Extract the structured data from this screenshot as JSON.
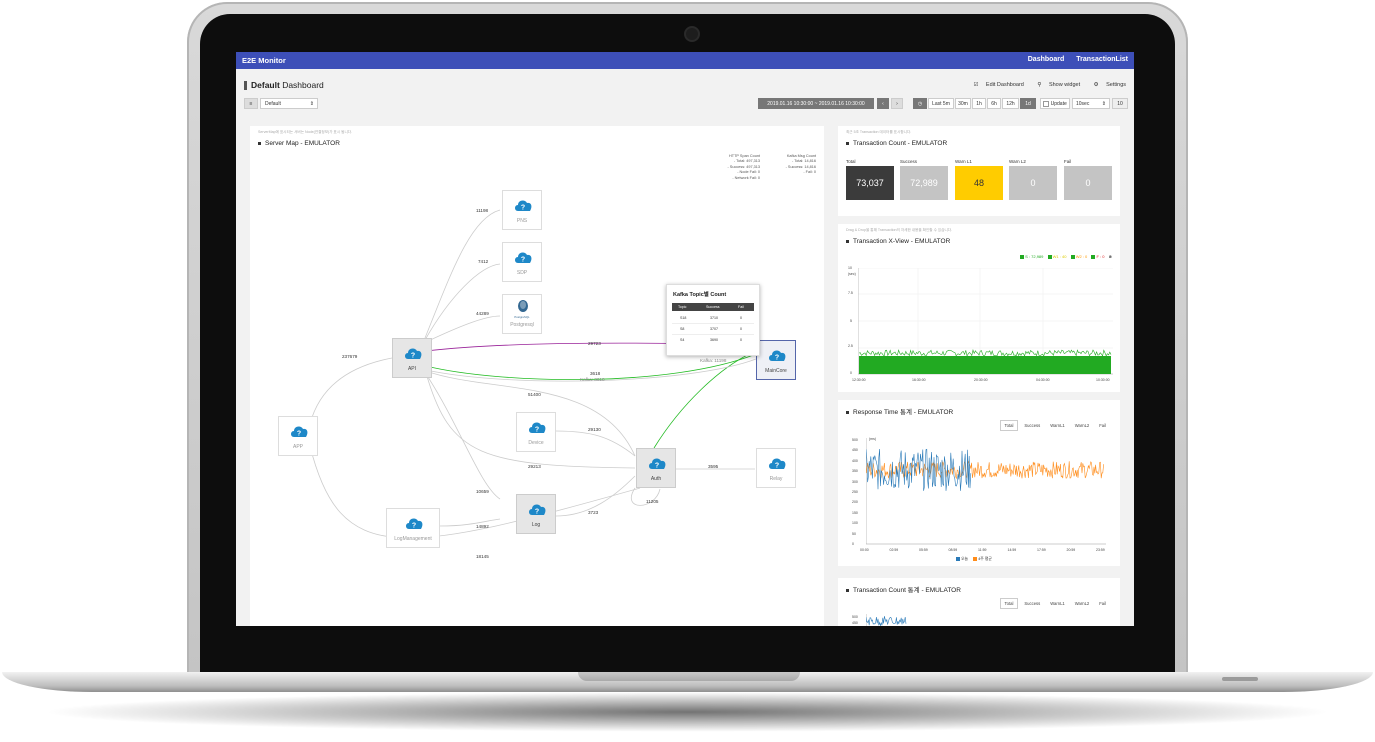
{
  "app": {
    "brand": "E2E Monitor",
    "nav": [
      "Dashboard",
      "TransactionList"
    ]
  },
  "page": {
    "title_bold": "Default",
    "title_rest": "Dashboard",
    "links": [
      "Edit Dashboard",
      "Show widget",
      "Settings"
    ]
  },
  "controls": {
    "dashboard_select": "Default",
    "date_range": "2019.01.16 10:30:00 ~ 2019.01.16 10:30:00",
    "ranges": [
      "Last 5m",
      "30m",
      "1h",
      "6h",
      "12h",
      "1d"
    ],
    "active_range": "1d",
    "update_label": "Update",
    "interval": "10sec",
    "go": "10"
  },
  "server_map": {
    "hint": "ServerMap에 표시되는 서버는 Node(연결정보)가 표시 됩니다.",
    "title": "Server Map - EMULATOR",
    "legend_http_title": "HTTP Span Count",
    "legend_http": [
      "- Total: 497,313",
      "- Success: 497,313",
      "- Node Fail: 0",
      "- Network Fail: 0"
    ],
    "legend_kafka_title": "Kafka Msg Count",
    "legend_kafka": [
      "- Total: 14,816",
      "- Success: 14,816",
      "- Fail: 0"
    ],
    "nodes": {
      "pns": "PNS",
      "sdp": "SDP",
      "postgres": "Postgresql",
      "api": "API",
      "app": "APP",
      "maincore": "MainCore",
      "device": "Device",
      "auth": "Auth",
      "relay": "Relay",
      "log": "Log",
      "logmgmt": "LogManagement"
    },
    "postgres_logo": "PostgreSQL",
    "edges": {
      "e11198": "11198",
      "e7412": "7412",
      "e44289": "44289",
      "e237679": "237679",
      "e29723": "29723",
      "e3618": "3618",
      "kafka_a": "Kafka: 3618",
      "e3711": "3711",
      "kafka_b": "Kafka: 11198",
      "e51400": "51400",
      "e29130": "29130",
      "e29213": "29213",
      "e3595": "3595",
      "e10659": "10659",
      "e14892": "14892",
      "e3723": "3723",
      "e11205": "11205",
      "e18145": "18145"
    },
    "tooltip": {
      "title": "Kafka Topic별 Count",
      "headers": [
        "Topic",
        "Success",
        "Fail"
      ],
      "rows": [
        [
          "S18",
          "3710",
          "0"
        ],
        [
          "S8",
          "3707",
          "0"
        ],
        [
          "S4",
          "3690",
          "0"
        ]
      ]
    }
  },
  "txn_count": {
    "hint": "최근 5초 Transaction 데이터를 표시합니다.",
    "title": "Transaction Count - EMULATOR",
    "cards": [
      {
        "label": "Total",
        "value": "73,037",
        "color": "#3b3b3b"
      },
      {
        "label": "Success",
        "value": "72,989",
        "color": "#c4c4c4"
      },
      {
        "label": "Warn L1",
        "value": "48",
        "color": "#ffcc00"
      },
      {
        "label": "Warn L2",
        "value": "0",
        "color": "#c4c4c4"
      },
      {
        "label": "Fail",
        "value": "0",
        "color": "#c4c4c4"
      }
    ]
  },
  "xview": {
    "hint": "Drag & Drop을 통해 Transaction의 자세한 내용을 확인할 수 있습니다.",
    "title": "Transaction X-View - EMULATOR",
    "legend": [
      {
        "text": "S : 72,989",
        "color": "#22aa22"
      },
      {
        "text": "W1 : 40",
        "color": "#ddcc00"
      },
      {
        "text": "W2 : 0",
        "color": "#ff9900"
      },
      {
        "text": "F : 0",
        "color": "#dd2222"
      }
    ],
    "ylabel": "(sec)",
    "yticks": [
      "10",
      "7.5",
      "5",
      "2.5",
      "0"
    ],
    "xticks": [
      "12:30:00",
      "16:30:00",
      "20:30:00",
      "04:30:00",
      "10:30:00"
    ]
  },
  "response": {
    "title": "Response Time 통계 - EMULATOR",
    "tabs": [
      "Total",
      "Success",
      "WarnL1",
      "WarnL2",
      "Fail"
    ],
    "yticks": [
      "500",
      "450",
      "400",
      "350",
      "300",
      "250",
      "200",
      "150",
      "100",
      "50",
      "0"
    ],
    "xticks": [
      "00:00",
      "02:59",
      "05:59",
      "08:59",
      "11:59",
      "14:59",
      "17:59",
      "20:59",
      "23:59"
    ],
    "ylabel": "(ms)",
    "series_names": [
      "오늘",
      "4주 평균"
    ],
    "colors": [
      "#2a7ab8",
      "#ff8c1a"
    ]
  },
  "txn_stats": {
    "title": "Transaction Count 통계 - EMULATOR",
    "tabs": [
      "Total",
      "Success",
      "WarnL1",
      "WarnL2",
      "Fail"
    ],
    "yticks": [
      "500",
      "450"
    ]
  }
}
